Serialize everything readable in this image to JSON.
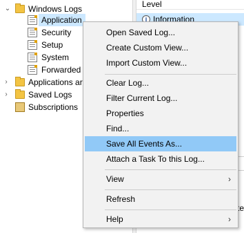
{
  "tree": {
    "windows_logs": "Windows Logs",
    "logs": [
      "Application",
      "Security",
      "Setup",
      "System",
      "Forwarded"
    ],
    "applications_and_services": "Applications ar",
    "saved_logs": "Saved Logs",
    "subscriptions": "Subscriptions"
  },
  "event_list": {
    "column_header": "Level",
    "selected_row": "Information",
    "peek_text": "te"
  },
  "context_menu": {
    "open_saved_log": "Open Saved Log...",
    "create_custom_view": "Create Custom View...",
    "import_custom_view": "Import Custom View...",
    "clear_log": "Clear Log...",
    "filter_current_log": "Filter Current Log...",
    "properties": "Properties",
    "find": "Find...",
    "save_all_events_as": "Save All Events As...",
    "attach_task": "Attach a Task To this Log...",
    "view": "View",
    "refresh": "Refresh",
    "help": "Help",
    "submenu_arrow": "›",
    "highlighted_item": "Save All Events As..."
  },
  "colors": {
    "selection": "#cce8ff",
    "menu_highlight": "#91c9f7",
    "menu_background": "#f2f2f2"
  }
}
